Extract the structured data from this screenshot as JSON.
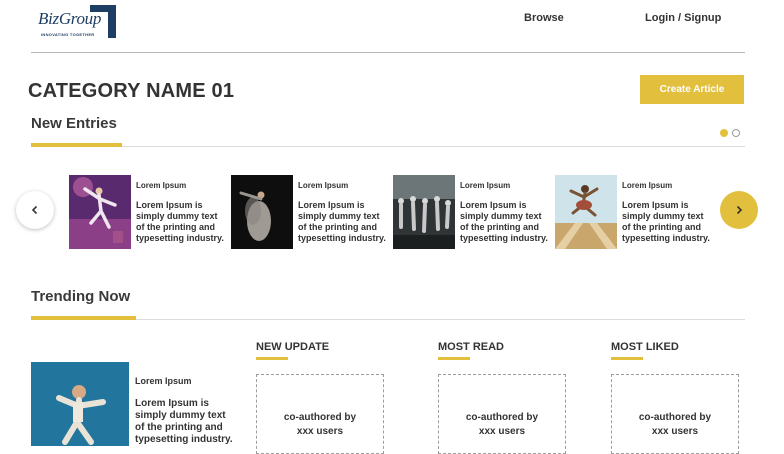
{
  "header": {
    "logo_text": "BizGroup",
    "logo_tagline": "INNOVATING TOGETHER",
    "nav": {
      "browse": "Browse",
      "login": "Login / Signup"
    }
  },
  "page": {
    "category": "CATEGORY NAME 01",
    "create_button": "Create Article"
  },
  "new_entries": {
    "title": "New Entries",
    "page_indicator": {
      "pages": 2,
      "active": 1
    },
    "items": [
      {
        "label": "Lorem Ipsum",
        "description": "Lorem Ipsum is simply dummy text of the printing and typesetting industry.",
        "image": "dancer-purple-photo"
      },
      {
        "label": "Lorem Ipsum",
        "description": "Lorem Ipsum is simply dummy text of the printing and typesetting industry.",
        "image": "dancer-dark-photo"
      },
      {
        "label": "Lorem Ipsum",
        "description": "Lorem Ipsum is simply dummy text of the printing and typesetting industry.",
        "image": "dance-group-photo"
      },
      {
        "label": "Lorem Ipsum",
        "description": "Lorem Ipsum is simply dummy text of the printing and typesetting industry.",
        "image": "dancer-jump-photo"
      }
    ],
    "prev_icon": "chevron-left-icon",
    "next_icon": "chevron-right-icon"
  },
  "trending": {
    "title": "Trending Now",
    "feature": {
      "label": "Lorem Ipsum",
      "description": "Lorem Ipsum is simply dummy text of the printing and typesetting industry.",
      "image": "dancer-blue-photo"
    },
    "columns": [
      {
        "title": "NEW UPDATE",
        "box_line1": "co-authored by",
        "box_line2": "xxx users"
      },
      {
        "title": "MOST READ",
        "box_line1": "co-authored by",
        "box_line2": "xxx users"
      },
      {
        "title": "MOST LIKED",
        "box_line1": "co-authored by",
        "box_line2": "xxx users"
      }
    ]
  },
  "colors": {
    "accent": "#e2bf3d",
    "brand": "#1f3e63",
    "text": "#333333"
  }
}
